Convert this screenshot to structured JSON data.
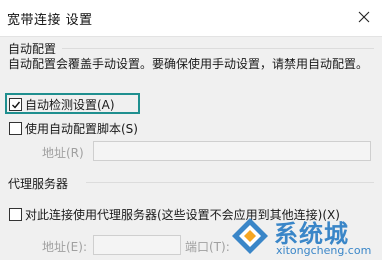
{
  "window": {
    "title": "宽带连接 设置",
    "close_icon": "close-icon"
  },
  "auto_config": {
    "group_label": "自动配置",
    "description": "自动配置会覆盖手动设置。要确保使用手动设置，请禁用自动配置。",
    "auto_detect": {
      "label": "自动检测设置(A)",
      "checked": true
    },
    "use_script": {
      "label": "使用自动配置脚本(S)",
      "checked": false
    },
    "address_label": "地址(R)",
    "address_value": ""
  },
  "proxy": {
    "group_label": "代理服务器",
    "use_proxy": {
      "label": "对此连接使用代理服务器(这些设置不会应用到其他连接)(X)",
      "checked": false
    },
    "address_label": "地址(E):",
    "address_value": "",
    "port_label": "端口(T):",
    "port_value": ""
  },
  "watermark": {
    "text_cn": "系统城",
    "text_en": "xitongcheng.com",
    "color": "#3a86c8"
  }
}
